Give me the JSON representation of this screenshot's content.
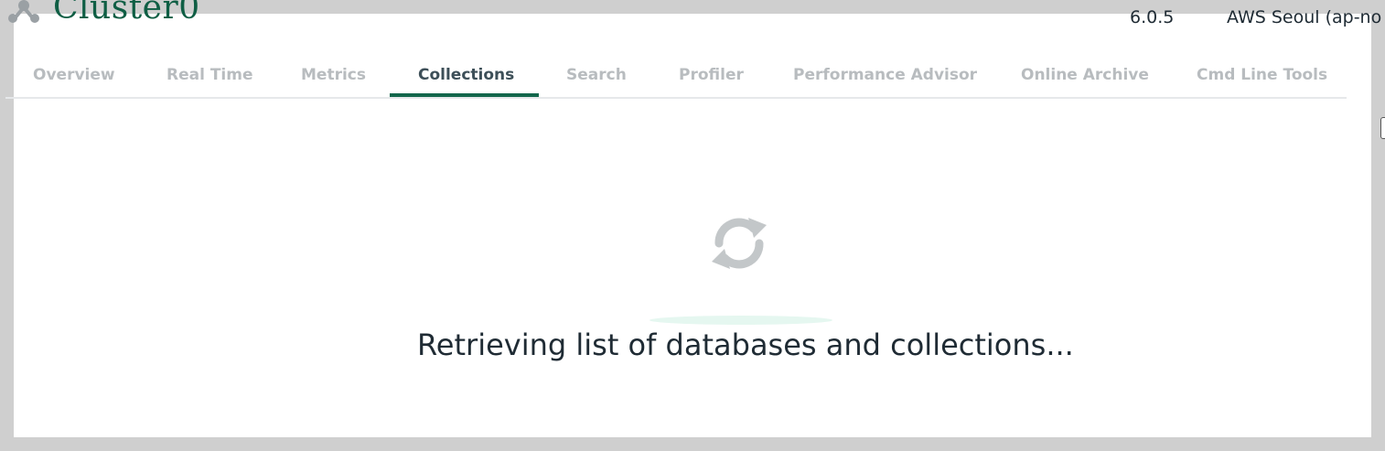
{
  "header": {
    "cluster_name": "Cluster0",
    "version": "6.0.5",
    "region": "AWS Seoul (ap-no"
  },
  "tabs": [
    {
      "label": "Overview",
      "active": false
    },
    {
      "label": "Real Time",
      "active": false
    },
    {
      "label": "Metrics",
      "active": false
    },
    {
      "label": "Collections",
      "active": true
    },
    {
      "label": "Search",
      "active": false
    },
    {
      "label": "Profiler",
      "active": false
    },
    {
      "label": "Performance Advisor",
      "active": false
    },
    {
      "label": "Online Archive",
      "active": false
    },
    {
      "label": "Cmd Line Tools",
      "active": false
    }
  ],
  "loading": {
    "message": "Retrieving list of databases and collections...",
    "icon": "refresh-icon"
  },
  "colors": {
    "brand": "#13674c",
    "active_tab_text": "#3d4f58",
    "inactive_tab_text": "#b8bcbf",
    "text": "#1f2b34"
  }
}
